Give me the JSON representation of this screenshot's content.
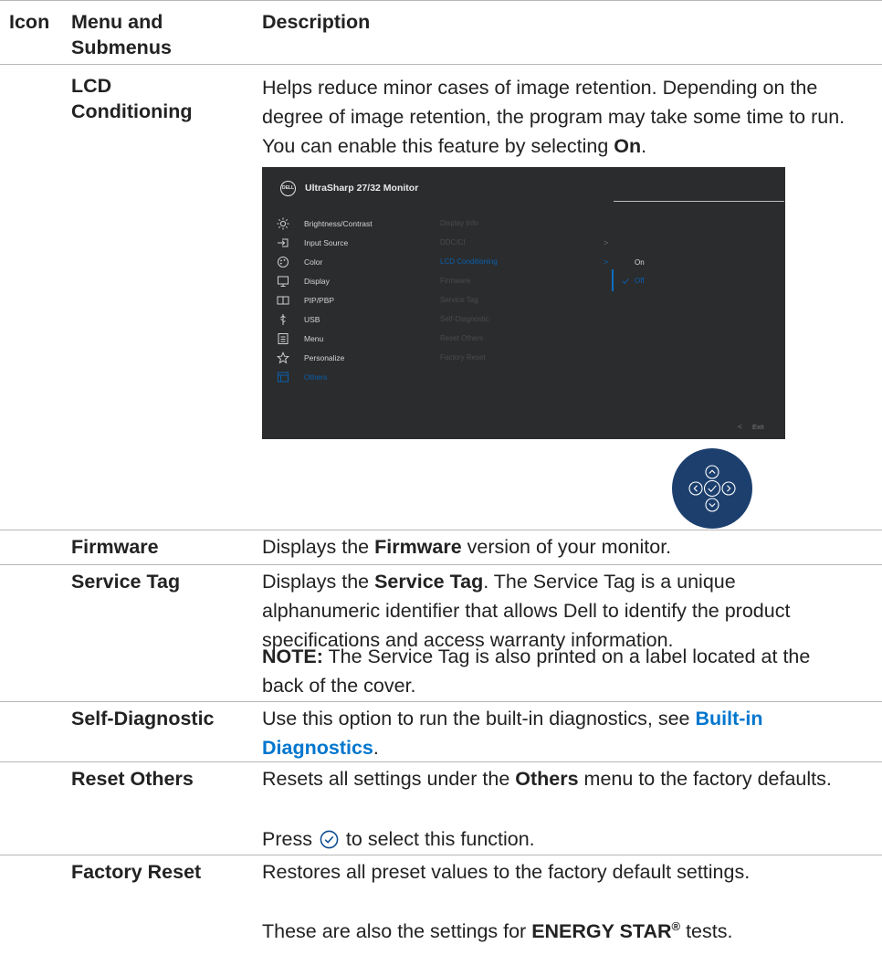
{
  "header": {
    "col_icon": "Icon",
    "col_menu": "Menu and Submenus",
    "col_desc": "Description"
  },
  "rows": {
    "lcd": {
      "name": "LCD Conditioning",
      "desc_1": "Helps reduce minor cases of image retention. Depending on the degree of image retention, the program may take some time to run. You can enable this feature by selecting ",
      "desc_bold": "On",
      "desc_end": "."
    },
    "firmware": {
      "name": "Firmware",
      "desc_a": "Displays the ",
      "desc_bold": "Firmware",
      "desc_b": " version of your monitor."
    },
    "service_tag": {
      "name": "Service Tag",
      "desc_a": "Displays the ",
      "desc_bold": "Service Tag",
      "desc_b": ". The Service Tag is a unique alphanumeric identifier that allows Dell to identify the product specifications and access warranty information.",
      "note_label": "NOTE:",
      "note_text": " The Service Tag is also printed on a label located at the back of the cover."
    },
    "self_diag": {
      "name": "Self-Diagnostic",
      "desc_a": "Use this option to run the built-in diagnostics, see ",
      "link": "Built-in Diagnostics",
      "desc_b": "."
    },
    "reset_others": {
      "name": "Reset Others",
      "desc_a": "Resets all settings under the ",
      "desc_bold": "Others",
      "desc_b": " menu to the factory defaults.",
      "press_a": "Press ",
      "press_b": " to select this function."
    },
    "factory_reset": {
      "name": "Factory Reset",
      "desc_1": "Restores all preset values to the factory default settings.",
      "desc_2a": "These are also the settings for ",
      "desc_2bold": "ENERGY STAR",
      "desc_2sup": "®",
      "desc_2b": " tests."
    }
  },
  "osd": {
    "logo_text": "DELL",
    "title": "UltraSharp 27/32 Monitor",
    "menu": [
      {
        "label": "Brightness/Contrast",
        "icon": "brightness-icon"
      },
      {
        "label": "Input Source",
        "icon": "input-source-icon"
      },
      {
        "label": "Color",
        "icon": "color-icon"
      },
      {
        "label": "Display",
        "icon": "display-icon"
      },
      {
        "label": "PIP/PBP",
        "icon": "pip-pbp-icon"
      },
      {
        "label": "USB",
        "icon": "usb-icon"
      },
      {
        "label": "Menu",
        "icon": "menu-icon"
      },
      {
        "label": "Personalize",
        "icon": "personalize-star-icon"
      },
      {
        "label": "Others",
        "icon": "others-icon"
      }
    ],
    "selected_menu": "Others",
    "submenu": [
      "Display Info",
      "DDC/CI",
      "LCD Conditioning",
      "Firmware",
      "Service Tag",
      "Self-Diagnostic",
      "Reset Others",
      "Factory Reset"
    ],
    "selected_submenu": "LCD Conditioning",
    "options": [
      "On",
      "Off"
    ],
    "selected_option": "Off",
    "exit_label": "Exit",
    "accent_color": "#0a5fab",
    "background_color": "#2b2c2e"
  },
  "joystick": {
    "buttons": [
      "up-arrow-icon",
      "left-arrow-icon",
      "check-icon",
      "right-arrow-icon",
      "down-arrow-icon"
    ],
    "color": "#1c3f6e"
  }
}
